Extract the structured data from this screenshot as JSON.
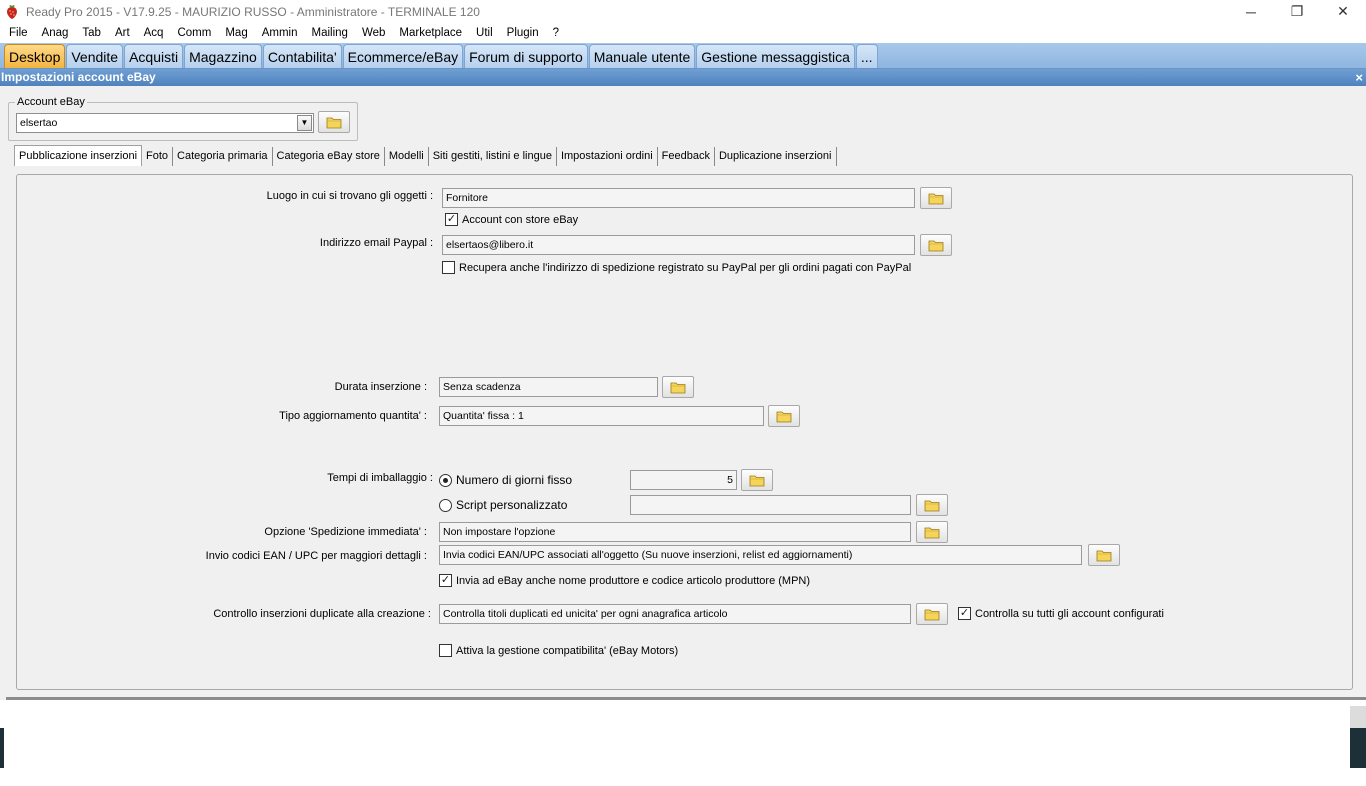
{
  "window": {
    "title": "Ready Pro 2015 - V17.9.25 - MAURIZIO RUSSO - Amministratore - TERMINALE 120",
    "minimize": "─",
    "restore": "❐",
    "close": "✕"
  },
  "menu": [
    "File",
    "Anag",
    "Tab",
    "Art",
    "Acq",
    "Comm",
    "Mag",
    "Ammin",
    "Mailing",
    "Web",
    "Marketplace",
    "Util",
    "Plugin",
    "?"
  ],
  "main_tabs": [
    "Desktop",
    "Vendite",
    "Acquisti",
    "Magazzino",
    "Contabilita'",
    "Ecommerce/eBay",
    "Forum di supporto",
    "Manuale utente",
    "Gestione messaggistica",
    "..."
  ],
  "panel": {
    "title": "Impostazioni account eBay",
    "close": "×"
  },
  "account": {
    "legend": "Account eBay",
    "value": "elsertao"
  },
  "sub_tabs": [
    "Pubblicazione inserzioni",
    "Foto",
    "Categoria primaria",
    "Categoria eBay store",
    "Modelli",
    "Siti gestiti, listini e lingue",
    "Impostazioni ordini",
    "Feedback",
    "Duplicazione inserzioni"
  ],
  "form": {
    "luogo_label": "Luogo in cui si trovano gli oggetti :",
    "luogo_value": "Fornitore",
    "store_check": "Account con store eBay",
    "email_label": "Indirizzo email Paypal :",
    "email_value": "elsertaos@libero.it",
    "paypal_check": "Recupera anche l'indirizzo di spedizione registrato su PayPal per gli ordini pagati con PayPal",
    "durata_label": "Durata inserzione :",
    "durata_value": "Senza scadenza",
    "tipo_label": "Tipo aggiornamento quantita' :",
    "tipo_value": "Quantita' fissa : 1",
    "tempi_label": "Tempi di imballaggio :",
    "radio_fisso": "Numero di giorni fisso",
    "fisso_value": "5",
    "radio_script": "Script personalizzato",
    "opzione_label": "Opzione 'Spedizione immediata' :",
    "opzione_value": "Non impostare l'opzione",
    "ean_label": "Invio codici EAN / UPC per maggiori dettagli :",
    "ean_value": "Invia codici EAN/UPC associati all'oggetto (Su nuove inserzioni, relist ed aggiornamenti)",
    "mpn_check": "Invia ad eBay anche nome produttore e codice articolo produttore (MPN)",
    "dup_label": "Controllo inserzioni duplicate alla creazione :",
    "dup_value": "Controlla titoli duplicati ed unicita' per ogni anagrafica articolo",
    "dup_all_check": "Controlla su tutti gli account configurati",
    "motors_check": "Attiva la gestione compatibilita' (eBay Motors)"
  },
  "checkmark": "✓"
}
